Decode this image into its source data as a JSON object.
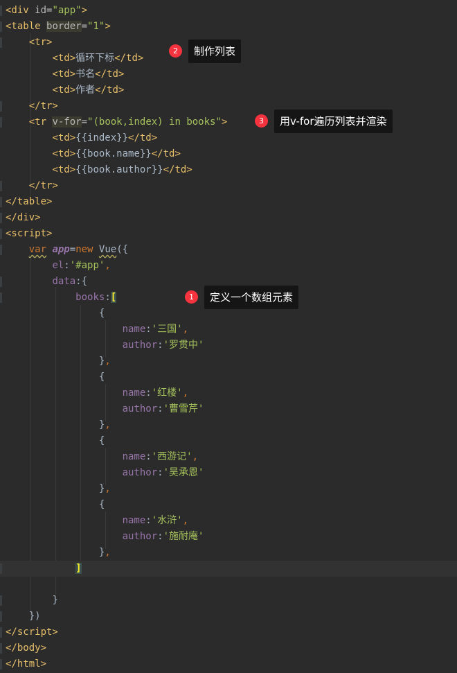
{
  "lines": [
    "<div id=\"app\">",
    "<table border=\"1\">",
    "<tr>",
    "循环下标",
    "书名",
    "作者",
    "</tr>",
    "(book,index) in books",
    "{{index}}",
    "{{book.name}}",
    "{{book.author}}"
  ],
  "code": {
    "el_value": "'#app'",
    "books_key": "books",
    "items": [
      {
        "name": "'三国'",
        "author": "'罗贯中'"
      },
      {
        "name": "'红楼'",
        "author": "'曹雪芹'"
      },
      {
        "name": "'西游记'",
        "author": "'吴承恩'"
      },
      {
        "name": "'水浒'",
        "author": "'施耐庵'"
      }
    ]
  },
  "annotations": [
    {
      "num": "1",
      "text": "定义一个数组元素"
    },
    {
      "num": "2",
      "text": "制作列表"
    },
    {
      "num": "3",
      "text": "用v-for遍历列表并渲染"
    }
  ],
  "colors": {
    "background": "#2b2b2b",
    "tag": "#e8bf6a",
    "string": "#a5c25c",
    "keyword": "#cc7832",
    "property": "#9876aa",
    "badge": "#f5333f"
  }
}
